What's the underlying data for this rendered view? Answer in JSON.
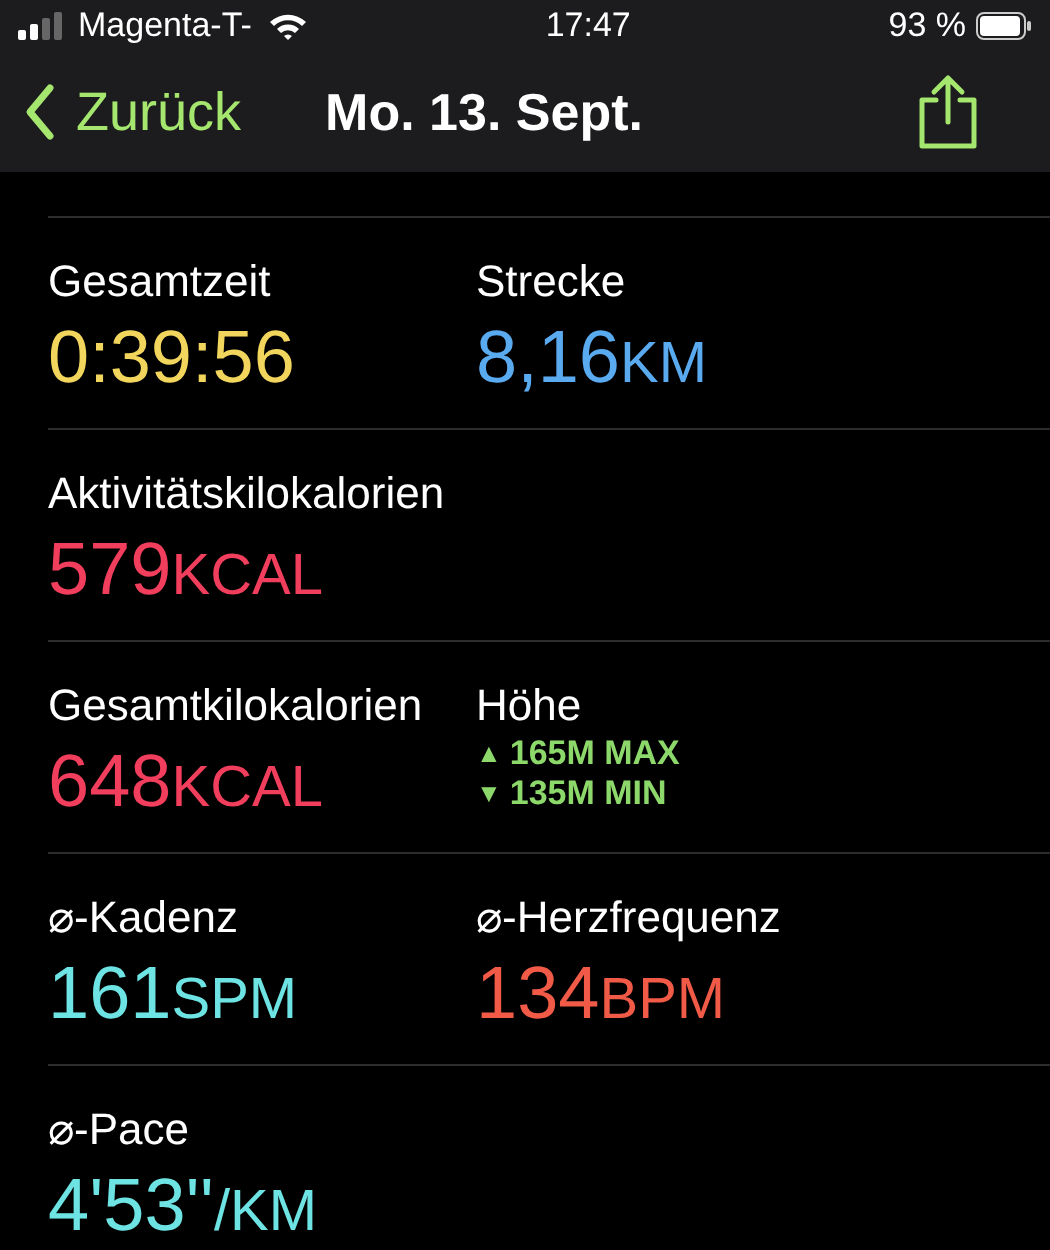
{
  "status_bar": {
    "carrier": "Magenta-T-",
    "time": "17:47",
    "battery": "93 %"
  },
  "nav": {
    "back": "Zurück",
    "title": "Mo. 13. Sept."
  },
  "rows": [
    [
      {
        "kind": "metric",
        "label": "Gesamtzeit",
        "value": "0:39:56",
        "color": "#f2d55c"
      },
      {
        "kind": "metric",
        "label": "Strecke",
        "value": "8,16",
        "unit": "KM",
        "color": "#5aaaf0"
      }
    ],
    [
      {
        "kind": "metric",
        "label": "Aktivitätskilokalorien",
        "value": "579",
        "unit": "KCAL",
        "color": "#f03e5c"
      }
    ],
    [
      {
        "kind": "metric",
        "label": "Gesamtkilokalorien",
        "value": "648",
        "unit": "KCAL",
        "color": "#f03e5c"
      },
      {
        "kind": "elevation",
        "label": "Höhe",
        "lines": [
          {
            "arrow": "▲",
            "text": "165M MAX"
          },
          {
            "arrow": "▼",
            "text": "135M MIN"
          }
        ],
        "color": "#8cd86a"
      }
    ],
    [
      {
        "kind": "metric",
        "label": "⌀-Kadenz",
        "value": "161",
        "unit": "SPM",
        "color": "#6ee3e3"
      },
      {
        "kind": "metric",
        "label": "⌀-Herzfrequenz",
        "value": "134",
        "unit": "BPM",
        "color": "#f05a46"
      }
    ],
    [
      {
        "kind": "metric",
        "label": "⌀-Pace",
        "value": "4'53''",
        "unit": "/KM",
        "color": "#6ee3e3"
      }
    ]
  ]
}
